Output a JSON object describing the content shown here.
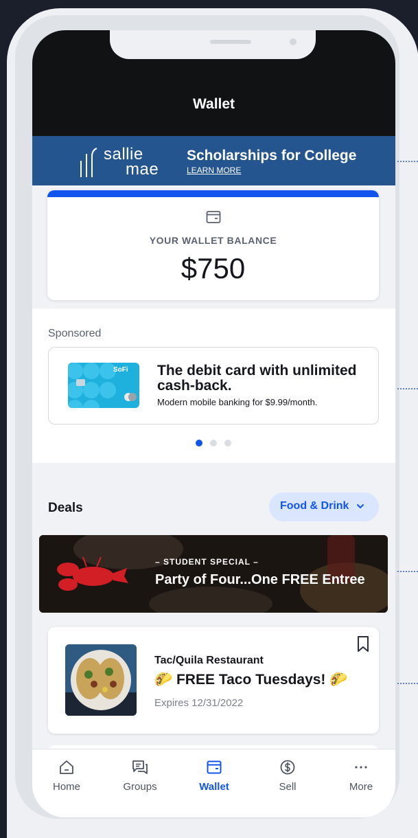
{
  "header": {
    "title": "Wallet"
  },
  "banner": {
    "brand_line1": "sallie",
    "brand_line2": "mae",
    "title": "Scholarships for College",
    "link": "LEARN MORE"
  },
  "balance": {
    "label": "YOUR WALLET BALANCE",
    "value": "$750"
  },
  "sponsored": {
    "label": "Sponsored",
    "ad": {
      "card_brand": "SoFi",
      "title": "The debit card with unlimited cash-back.",
      "subtitle": "Modern mobile banking for $9.99/month."
    },
    "carousel_active_index": 0,
    "carousel_count": 3
  },
  "deals": {
    "title": "Deals",
    "filter": {
      "label": "Food & Drink"
    },
    "promo": {
      "subtitle": "– STUDENT SPECIAL –",
      "title": "Party of Four...One FREE Entree"
    },
    "items": [
      {
        "restaurant": "Tac/Quila Restaurant",
        "title": "🌮 FREE Taco Tuesdays! 🌮",
        "expiry": "Expires 12/31/2022"
      }
    ]
  },
  "nav": {
    "items": [
      {
        "label": "Home",
        "icon": "home-icon"
      },
      {
        "label": "Groups",
        "icon": "chat-icon"
      },
      {
        "label": "Wallet",
        "icon": "wallet-icon"
      },
      {
        "label": "Sell",
        "icon": "dollar-icon"
      },
      {
        "label": "More",
        "icon": "ellipsis-icon"
      }
    ],
    "active": "Wallet"
  },
  "colors": {
    "accent": "#1155ee",
    "banner_bg": "#24558f",
    "header_bg": "#111214",
    "filter_bg": "#d9e6fd"
  }
}
